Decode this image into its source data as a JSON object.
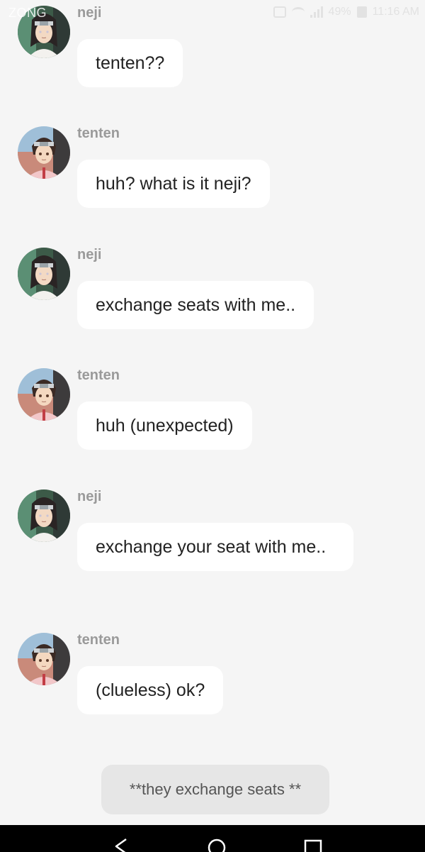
{
  "status_bar": {
    "carrier": "ZONG",
    "battery": "49%",
    "time": "11:16 AM"
  },
  "messages": [
    {
      "sender": "neji",
      "avatar": "neji-avatar",
      "text": "tenten??"
    },
    {
      "sender": "tenten",
      "avatar": "tenten-avatar",
      "text": "huh?  what is it neji?"
    },
    {
      "sender": "neji",
      "avatar": "neji-avatar",
      "text": "exchange seats with me.."
    },
    {
      "sender": "tenten",
      "avatar": "tenten-avatar",
      "text": "huh (unexpected)"
    },
    {
      "sender": "neji",
      "avatar": "neji-avatar",
      "text": "exchange your seat with me.."
    },
    {
      "sender": "tenten",
      "avatar": "tenten-avatar",
      "text": "(clueless) ok?"
    }
  ],
  "narration": "**they exchange seats **",
  "nav_bar": {
    "icons": [
      "back-triangle-icon",
      "home-circle-icon",
      "recents-square-icon"
    ]
  },
  "colors": {
    "background": "#f5f5f5",
    "bubble": "#ffffff",
    "narration_bubble": "#e6e6e6",
    "sender_name": "#9a9a9a",
    "nav_bar": "#000000"
  }
}
